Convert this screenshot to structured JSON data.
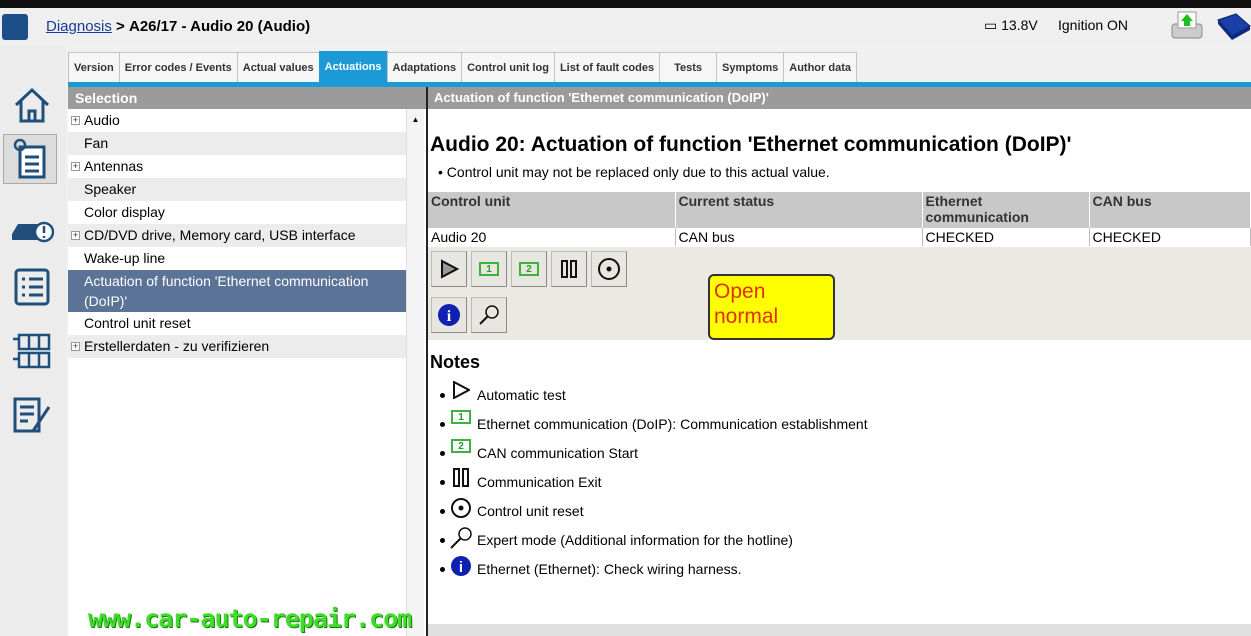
{
  "header": {
    "breadcrumb_link": "Diagnosis",
    "breadcrumb_sep": ">",
    "breadcrumb_current": "A26/17 - Audio 20 (Audio)",
    "voltage": "13.8V",
    "ignition": "Ignition ON"
  },
  "tabs": [
    "Version",
    "Error codes / Events",
    "Actual values",
    "Actuations",
    "Adaptations",
    "Control unit log",
    "List of fault codes",
    "Tests",
    "Symptoms",
    "Author data"
  ],
  "active_tab": "Actuations",
  "selection": {
    "title": "Selection",
    "items": [
      {
        "label": "Audio",
        "expandable": true
      },
      {
        "label": "Fan",
        "expandable": false
      },
      {
        "label": "Antennas",
        "expandable": true
      },
      {
        "label": "Speaker",
        "expandable": false
      },
      {
        "label": "Color display",
        "expandable": false
      },
      {
        "label": "CD/DVD drive, Memory card, USB interface",
        "expandable": true
      },
      {
        "label": "Wake-up line",
        "expandable": false
      },
      {
        "label": "Actuation of function 'Ethernet communication (DoIP)'",
        "expandable": false,
        "selected": true
      },
      {
        "label": "Control unit reset",
        "expandable": false
      },
      {
        "label": "Erstellerdaten - zu verifizieren",
        "expandable": true
      }
    ]
  },
  "detail": {
    "header": "Actuation of function 'Ethernet communication (DoIP)'",
    "title": "Audio 20: Actuation of function 'Ethernet communication (DoIP)'",
    "note": "Control unit may not be replaced only due to this actual value.",
    "table": {
      "columns": [
        "Control unit",
        "Current status",
        "Ethernet communication",
        "CAN bus"
      ],
      "rows": [
        [
          "Audio 20",
          "CAN bus",
          "CHECKED",
          "CHECKED"
        ]
      ]
    },
    "buttons": [
      "play-icon",
      "step-1-icon",
      "step-2-icon",
      "pause-icon",
      "reset-icon",
      "info-icon",
      "expert-mode-icon"
    ],
    "tooltip": "Open normal",
    "notes_title": "Notes",
    "notes": [
      {
        "icon": "play-icon",
        "text": "Automatic test"
      },
      {
        "icon": "step-1-icon",
        "text": "Ethernet communication (DoIP): Communication establishment"
      },
      {
        "icon": "step-2-icon",
        "text": "CAN communication Start"
      },
      {
        "icon": "pause-icon",
        "text": "Communication Exit"
      },
      {
        "icon": "reset-icon",
        "text": "Control unit reset"
      },
      {
        "icon": "expert-mode-icon",
        "text": "Expert mode (Additional information for the hotline)"
      },
      {
        "icon": "info-icon",
        "text": "Ethernet (Ethernet): Check wiring harness."
      }
    ]
  },
  "watermark": "www.car-auto-repair.com",
  "colors": {
    "accent": "#1b9ad6",
    "selected": "#5a7396",
    "tooltip": "#ffff00"
  }
}
